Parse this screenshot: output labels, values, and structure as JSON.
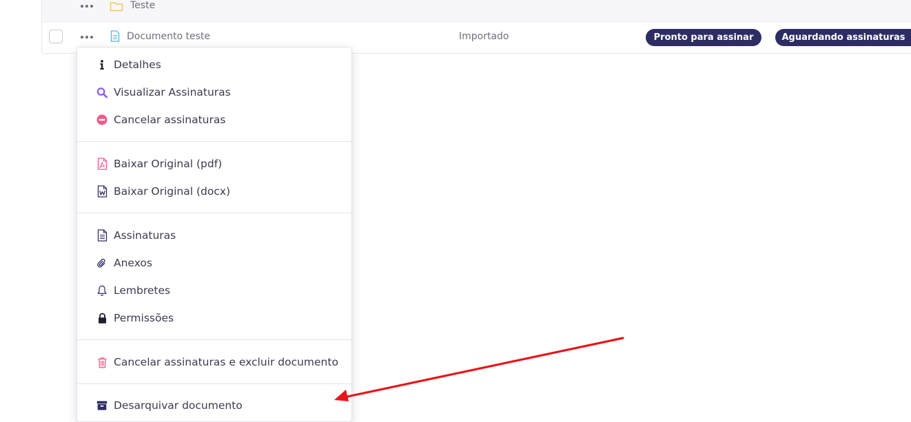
{
  "table": {
    "folder_row": {
      "name": "Teste"
    },
    "document_row": {
      "name": "Documento teste",
      "status": "Importado",
      "badges": [
        "Pronto para assinar",
        "Aguardando assinaturas"
      ]
    }
  },
  "context_menu": {
    "items": [
      {
        "label": "Detalhes",
        "icon": "info-icon"
      },
      {
        "label": "Visualizar Assinaturas",
        "icon": "search-icon"
      },
      {
        "label": "Cancelar assinaturas",
        "icon": "minus-circle-icon"
      },
      {
        "label": "Baixar Original (pdf)",
        "icon": "pdf-file-icon"
      },
      {
        "label": "Baixar Original (docx)",
        "icon": "word-file-icon"
      },
      {
        "label": "Assinaturas",
        "icon": "document-icon"
      },
      {
        "label": "Anexos",
        "icon": "paperclip-icon"
      },
      {
        "label": "Lembretes",
        "icon": "bell-icon"
      },
      {
        "label": "Permissões",
        "icon": "lock-icon"
      },
      {
        "label": "Cancelar assinaturas e excluir documento",
        "icon": "trash-icon"
      },
      {
        "label": "Desarquivar documento",
        "icon": "archive-icon"
      }
    ]
  },
  "colors": {
    "badge_bg": "#2e2d63",
    "folder_icon": "#f1c35a",
    "document_icon": "#4fb8e0",
    "search_icon": "#8b5cf6",
    "danger_icon": "#ef5a86",
    "annotation_arrow": "#e8151b"
  }
}
